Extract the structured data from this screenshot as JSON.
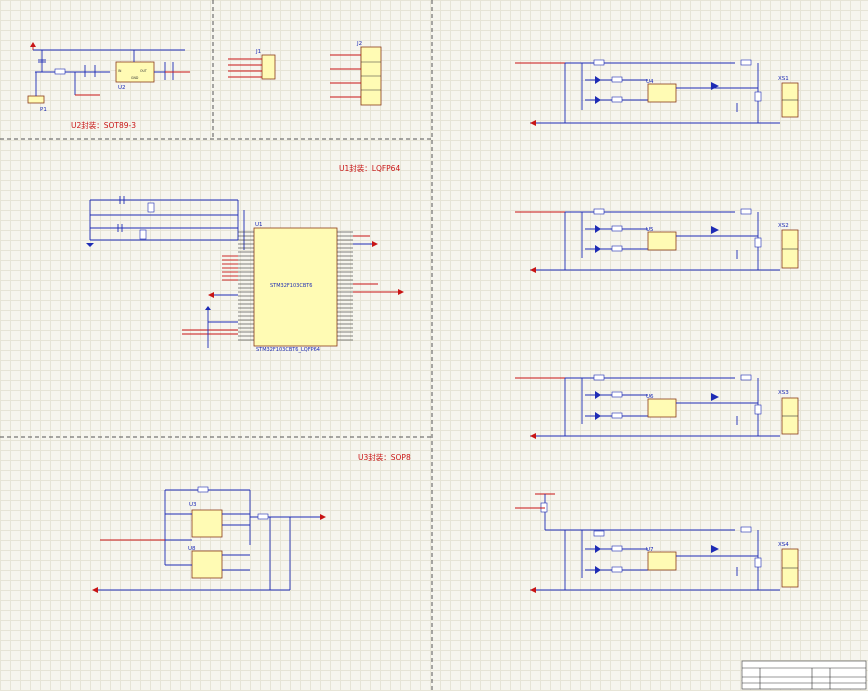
{
  "sections": {
    "power": {
      "note": "U2封装：SOT89-3",
      "regulator_ref": "U2",
      "power_jack_ref": "P1"
    },
    "headers": {
      "j1_ref": "J1",
      "j2_ref": "J2"
    },
    "mcu": {
      "note": "U1封装：LQFP64",
      "ref": "U1",
      "part": "STM32F103CBT6",
      "footprint": "STM32F103CBT6_LQFP64"
    },
    "drivers": {
      "note": "U3封装：SOP8",
      "ref_a": "U3",
      "ref_b": "U8"
    },
    "outputs": [
      {
        "opto_ref": "U4",
        "connector_ref": "XS1"
      },
      {
        "opto_ref": "U5",
        "connector_ref": "XS2"
      },
      {
        "opto_ref": "U6",
        "connector_ref": "XS3"
      },
      {
        "opto_ref": "U7",
        "connector_ref": "XS4"
      }
    ]
  },
  "colors": {
    "wire": "#1d2bb5",
    "net_label": "#c81414",
    "component_fill": "#fffbb4",
    "component_border": "#8a3a1a",
    "sheet_background": "#f6f5ee"
  }
}
